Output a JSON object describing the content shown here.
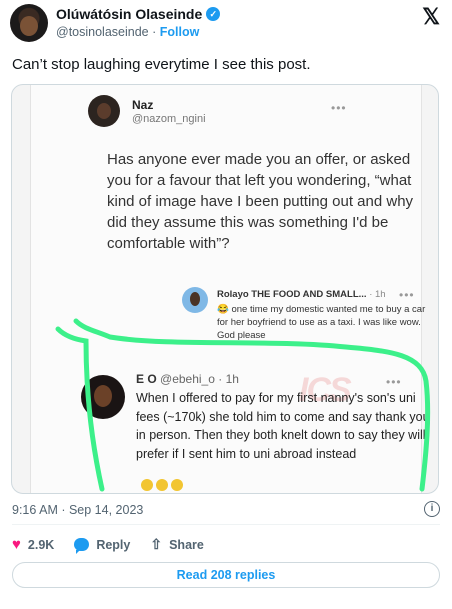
{
  "author": {
    "name": "Olúwátósin Olaseinde",
    "handle": "@tosinolaseinde",
    "separator": "·",
    "follow_label": "Follow",
    "verified_icon": "verified-badge-icon"
  },
  "brand_icon": "x-logo-icon",
  "tweet": {
    "text": "Can’t stop laughing everytime I see this post.",
    "timestamp": "9:16 AM · Sep 14, 2023"
  },
  "media": {
    "original_post": {
      "name": "Naz",
      "handle": "@nazom_ngini",
      "text": "Has anyone ever made you an offer, or asked you for a favour that left you wondering, “what kind of image have I been putting out and why did they assume this was something I'd be comfortable with”?"
    },
    "reply_one": {
      "name": "Rolayo THE FOOD AND SMALL...",
      "time": "· 1h",
      "text": "😂 one time my domestic wanted me to buy a car for her boyfriend to use as a taxi. I was like wow. God please"
    },
    "reply_two": {
      "name": "E O",
      "handle": "@ebehi_o",
      "time": "· 1h",
      "text": "When I offered to pay for my first nanny's son's uni fees (~170k) she told him to come and say thank you in person. Then they both knelt down to say they will prefer if I sent him to uni abroad instead"
    },
    "watermark": "ICS",
    "highlight_color": "#3cf08a"
  },
  "actions": {
    "likes": "2.9K",
    "reply_label": "Reply",
    "share_label": "Share"
  },
  "read_replies_label": "Read 208 replies",
  "colors": {
    "accent": "#1d9bf0",
    "like": "#f91880",
    "muted": "#536471"
  }
}
